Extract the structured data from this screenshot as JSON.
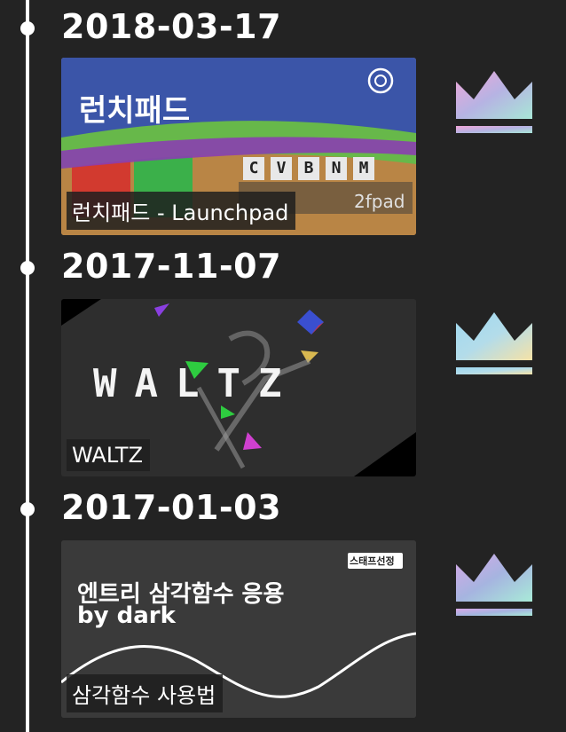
{
  "entries": [
    {
      "date": "2018-03-17",
      "thumb_title": "런치패드",
      "thumb_keys": [
        "C",
        "V",
        "B",
        "N",
        "M"
      ],
      "thumb_brand": "2fpad",
      "caption": "런치패드 - Launchpad",
      "crown_icon": "crown-icon"
    },
    {
      "date": "2017-11-07",
      "thumb_title": "WALTZ",
      "caption": "WALTZ",
      "crown_icon": "crown-icon"
    },
    {
      "date": "2017-01-03",
      "thumb_title_line1": "엔트리 삼각함수 응용",
      "thumb_title_line2": "by dark",
      "thumb_badge": "스태프선정",
      "caption": "삼각함수 사용법",
      "crown_icon": "crown-icon"
    }
  ],
  "colors": {
    "background": "#232323",
    "timeline": "#ffffff",
    "launchpad_blue": "#3b55a8",
    "launchpad_green": "#67b84a",
    "launchpad_purple": "#8a3fb0",
    "card_dark": "#2e2e2e",
    "card_graphite": "#3a3a3a"
  }
}
